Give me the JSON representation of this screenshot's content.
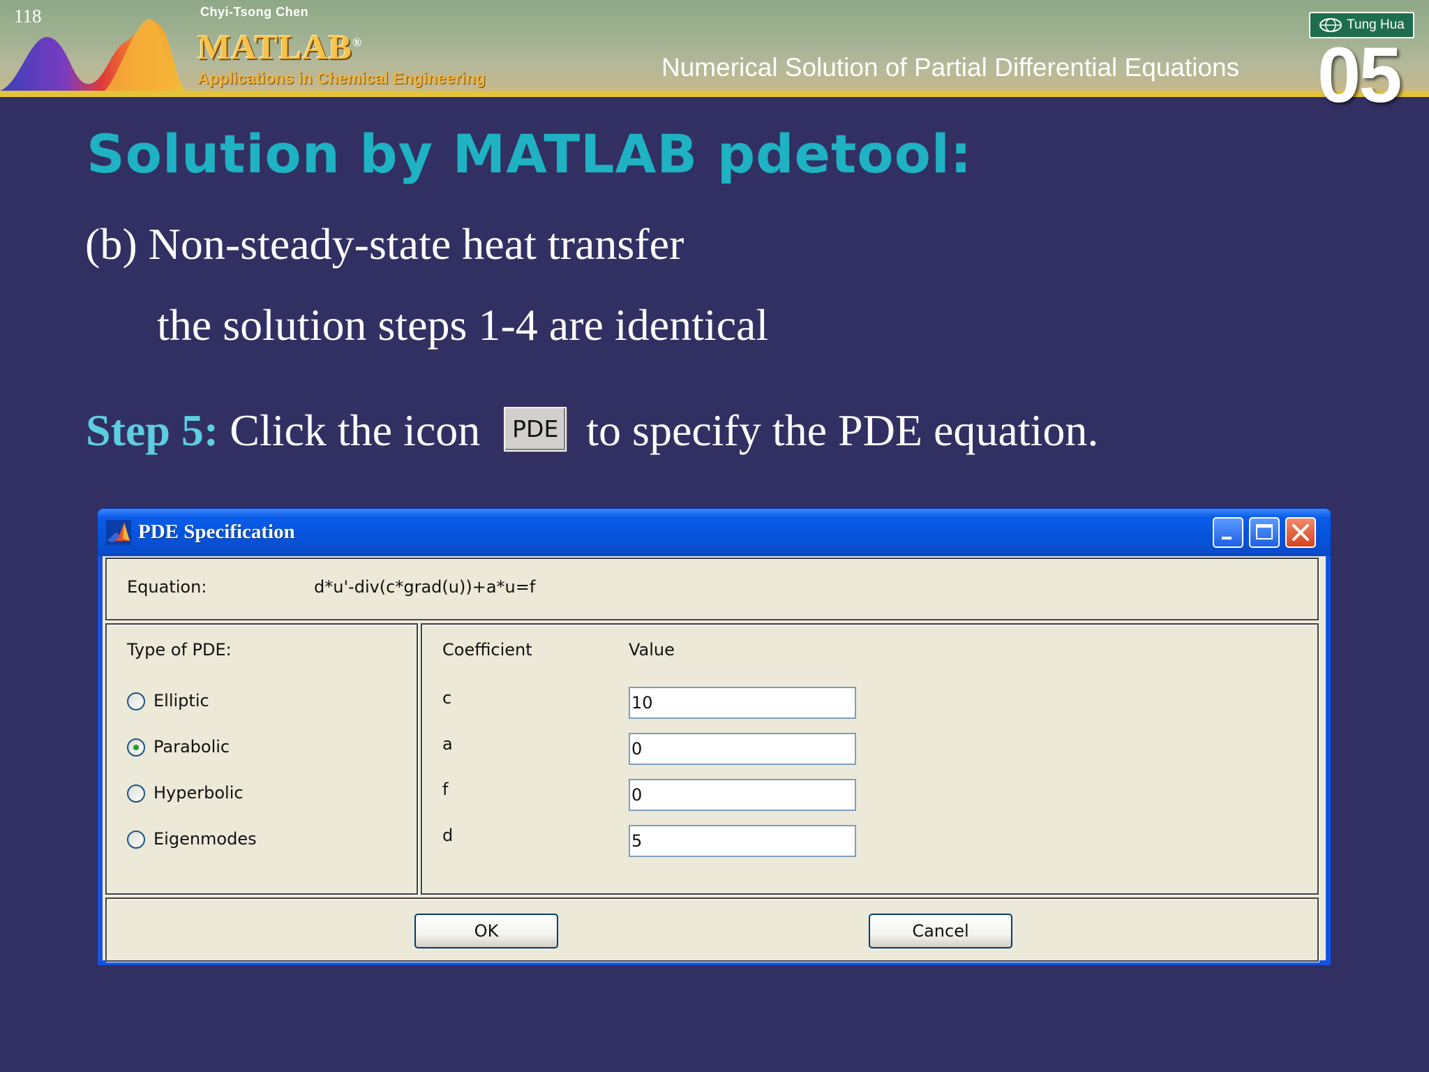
{
  "header": {
    "page_number": "118",
    "author": "Chyi-Tsong Chen",
    "book_brand": "MATLAB",
    "book_brand_mark": "®",
    "book_subtitle": "Applications in Chemical Engineering",
    "chapter_title": "Numerical Solution of Partial Differential Equations",
    "chapter_number": "05",
    "publisher": "Tung Hua"
  },
  "slide": {
    "title": "Solution by MATLAB pdetool:",
    "line_b": "(b) Non-steady-state heat transfer",
    "line_steps": "the solution steps 1-4 are identical",
    "step_label": "Step 5:",
    "step_text_before": " Click the icon",
    "pde_icon_label": "PDE",
    "step_text_after": "to specify the PDE equation."
  },
  "dialog": {
    "title": "PDE Specification",
    "equation_label": "Equation:",
    "equation_value": "d*u'-div(c*grad(u))+a*u=f",
    "type_label": "Type of PDE:",
    "pde_types": [
      {
        "label": "Elliptic",
        "checked": false
      },
      {
        "label": "Parabolic",
        "checked": true
      },
      {
        "label": "Hyperbolic",
        "checked": false
      },
      {
        "label": "Eigenmodes",
        "checked": false
      }
    ],
    "coefficient_header": "Coefficient",
    "value_header": "Value",
    "coefficients": [
      {
        "name": "c",
        "value": "10"
      },
      {
        "name": "a",
        "value": "0"
      },
      {
        "name": "f",
        "value": "0"
      },
      {
        "name": "d",
        "value": "5"
      }
    ],
    "ok_label": "OK",
    "cancel_label": "Cancel"
  },
  "colors": {
    "background": "#323062",
    "title_accent": "#1eb2c3",
    "step_accent": "#5ecde0",
    "window_blue": "#1453e0",
    "dialog_face": "#ece9d8",
    "banner_stripe": "#e3c33a"
  }
}
